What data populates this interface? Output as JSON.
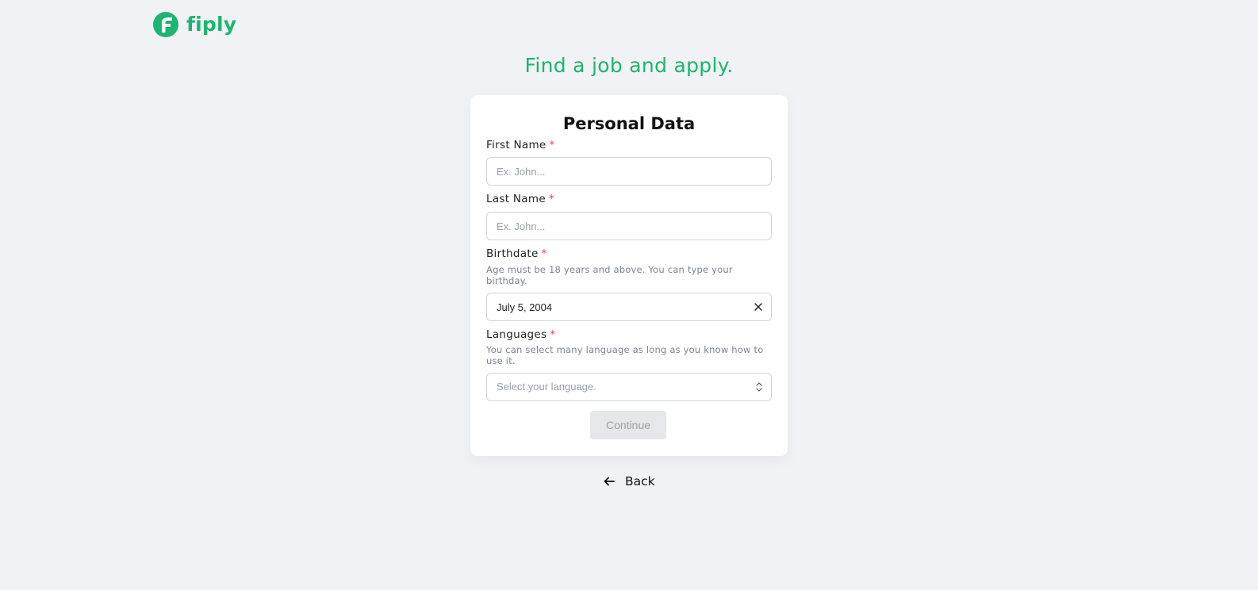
{
  "brand": {
    "name": "fiply",
    "color": "#1db56f"
  },
  "tagline": "Find a job and apply.",
  "form": {
    "title": "Personal Data",
    "required_marker": "*",
    "first_name": {
      "label": "First Name",
      "placeholder": "Ex. John...",
      "value": ""
    },
    "last_name": {
      "label": "Last Name",
      "placeholder": "Ex. John...",
      "value": ""
    },
    "birthdate": {
      "label": "Birthdate",
      "help": "Age must be 18 years and above. You can type your birthday.",
      "value": "July 5, 2004"
    },
    "languages": {
      "label": "Languages",
      "help": "You can select many language as long as you know how to use it.",
      "placeholder": "Select your language."
    },
    "continue_label": "Continue"
  },
  "back_label": "Back",
  "icons": {
    "logo": "fiply-logo-icon",
    "clear": "close-icon",
    "select": "chevron-updown-icon",
    "back": "arrow-left-icon"
  },
  "colors": {
    "accent": "#1db56f",
    "required": "#e5484d",
    "background": "#f0f2f5"
  }
}
